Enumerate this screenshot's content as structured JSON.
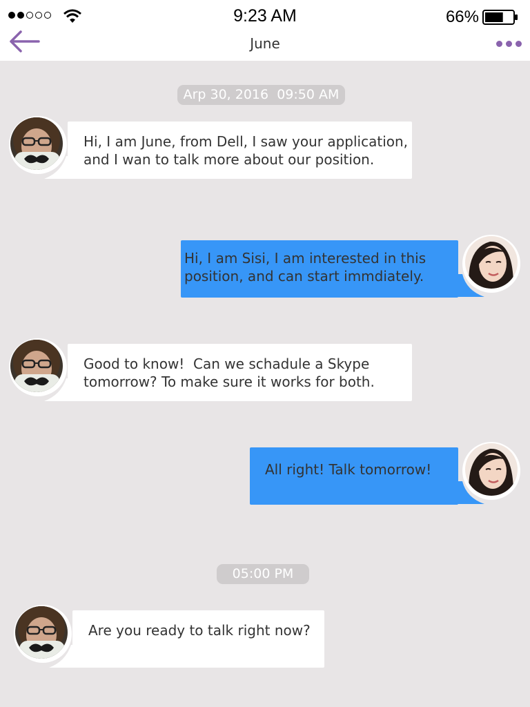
{
  "status_bar": {
    "time": "9:23 AM",
    "battery_percent": "66%",
    "signal_bars_filled": 2,
    "signal_bars_total": 5,
    "battery_level": 0.66
  },
  "header": {
    "title": "June",
    "back_icon": "back-arrow-icon",
    "more_icon": "more-dots-icon",
    "accent_color": "#8a63ad"
  },
  "conversation": {
    "timestamps": [
      "Arp 30, 2016  09:50 AM",
      "05:00 PM"
    ],
    "messages": [
      {
        "sender": "June",
        "direction": "incoming",
        "lines": [
          "Hi, I am June, from Dell, I saw your application,",
          "and I wan to talk more about our position."
        ]
      },
      {
        "sender": "Sisi",
        "direction": "outgoing",
        "lines": [
          "Hi, I am Sisi, I am interested in this",
          "position, and can start immdiately."
        ]
      },
      {
        "sender": "June",
        "direction": "incoming",
        "lines": [
          "Good to know!  Can we schadule a Skype",
          "tomorrow? To make sure it works for both."
        ]
      },
      {
        "sender": "Sisi",
        "direction": "outgoing",
        "lines": [
          "All right! Talk tomorrow!"
        ]
      },
      {
        "sender": "June",
        "direction": "incoming",
        "lines": [
          "Are you ready to talk right now?"
        ]
      }
    ]
  },
  "colors": {
    "background": "#e8e5e6",
    "incoming_bubble": "#ffffff",
    "outgoing_bubble": "#3796f7",
    "timestamp_pill": "#cfcccd"
  }
}
